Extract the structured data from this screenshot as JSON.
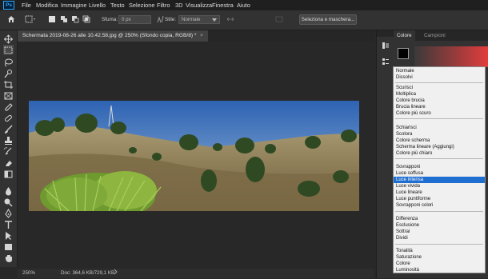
{
  "menubar": {
    "items": [
      "File",
      "Modifica",
      "Immagine",
      "Livello",
      "Testo",
      "Selezione",
      "Filtro",
      "3D",
      "Visualizza",
      "Finestra",
      "Aiuto"
    ]
  },
  "options": {
    "feather_label": "Sfuma:",
    "feather_value": "0 px",
    "style_label": "Stile:",
    "style_value": "Normale",
    "select_mask_button": "Seleziona e maschera..."
  },
  "document": {
    "tab_title": "Schermata 2019-08-26 alle 10.42.58.jpg @ 250% (Sfondo copia, RGB/8) *",
    "close_symbol": "×"
  },
  "status": {
    "zoom": "250%",
    "doc_info": "Doc: 364,6 KB/729,1 KB"
  },
  "panel": {
    "tabs": [
      "Colore",
      "Campioni"
    ]
  },
  "blend_modes": {
    "groups": [
      [
        "Normale",
        "Dissolvi"
      ],
      [
        "Scurisci",
        "Moltiplica",
        "Colore brucia",
        "Brucia lineare",
        "Colore più scuro"
      ],
      [
        "Schiarisci",
        "Scolora",
        "Colore scherma",
        "Scherma lineare (Aggiungi)",
        "Colore più chiaro"
      ],
      [
        "Sovrapponi",
        "Luce soffusa",
        "Luce intensa",
        "Luce vivida",
        "Luce lineare",
        "Luce puntiforme",
        "Sovrapponi colori"
      ],
      [
        "Differenza",
        "Esclusione",
        "Sottrai",
        "Dividi"
      ],
      [
        "Tonalità",
        "Saturazione",
        "Colore",
        "Luminosità"
      ]
    ],
    "selected": "Luce intensa"
  },
  "colors": {
    "selection_highlight": "#1f6fd1",
    "ps_brand": "#31a8ff"
  }
}
